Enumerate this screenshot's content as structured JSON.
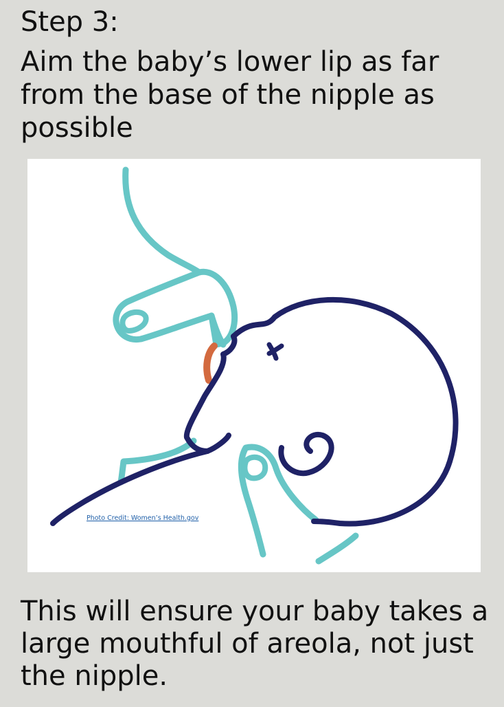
{
  "step": {
    "title": "Step 3:",
    "instruction": "Aim the baby’s lower lip as far from the base of the nipple as possible"
  },
  "illustration": {
    "credit": "Photo Credit: Women’s Health.gov",
    "colors": {
      "mother": "#67c6c6",
      "baby": "#1f2266",
      "areola": "#d36a3f",
      "panel": "#ffffff",
      "background": "#dcdcd8"
    }
  },
  "footer": {
    "text": "This will ensure your baby takes a large mouthful of areola, not just the nipple."
  }
}
